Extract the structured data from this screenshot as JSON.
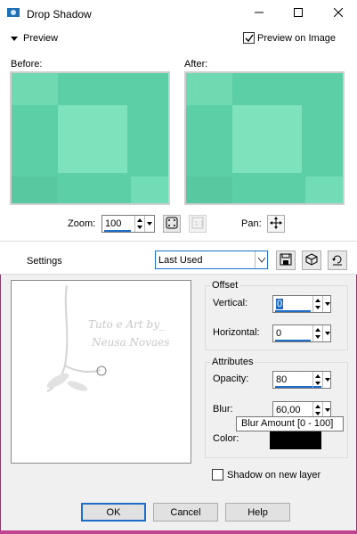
{
  "window": {
    "title": "Drop Shadow",
    "controls": [
      "minimize-icon",
      "maximize-icon",
      "close-icon"
    ]
  },
  "header": {
    "preview_label": "Preview",
    "preview_on_image_label": "Preview on Image",
    "preview_on_image_checked": true
  },
  "preview": {
    "before_label": "Before:",
    "after_label": "After:",
    "zoom_label": "Zoom:",
    "zoom_value": "100",
    "pan_label": "Pan:"
  },
  "settings": {
    "label": "Settings",
    "preset_value": "Last Used"
  },
  "watermark": {
    "line1": "Tuto e Art by_",
    "line2": "Neusa Novaes"
  },
  "offset": {
    "title": "Offset",
    "vertical_label": "Vertical:",
    "vertical_value": "0",
    "horizontal_label": "Horizontal:",
    "horizontal_value": "0"
  },
  "attributes": {
    "title": "Attributes",
    "opacity_label": "Opacity:",
    "opacity_value": "80",
    "blur_label": "Blur:",
    "blur_value": "60,00",
    "color_label": "Color:",
    "color_hex": "#000000",
    "blur_tooltip": "Blur Amount [0 - 100]"
  },
  "shadow_on_new_layer_label": "Shadow on new layer",
  "shadow_on_new_layer_checked": false,
  "buttons": {
    "ok": "OK",
    "cancel": "Cancel",
    "help": "Help"
  },
  "colors": {
    "accent": "#1e6ec8",
    "preview_fill": "#5fd0a8",
    "preview_fill_light": "#7fe0bc"
  }
}
